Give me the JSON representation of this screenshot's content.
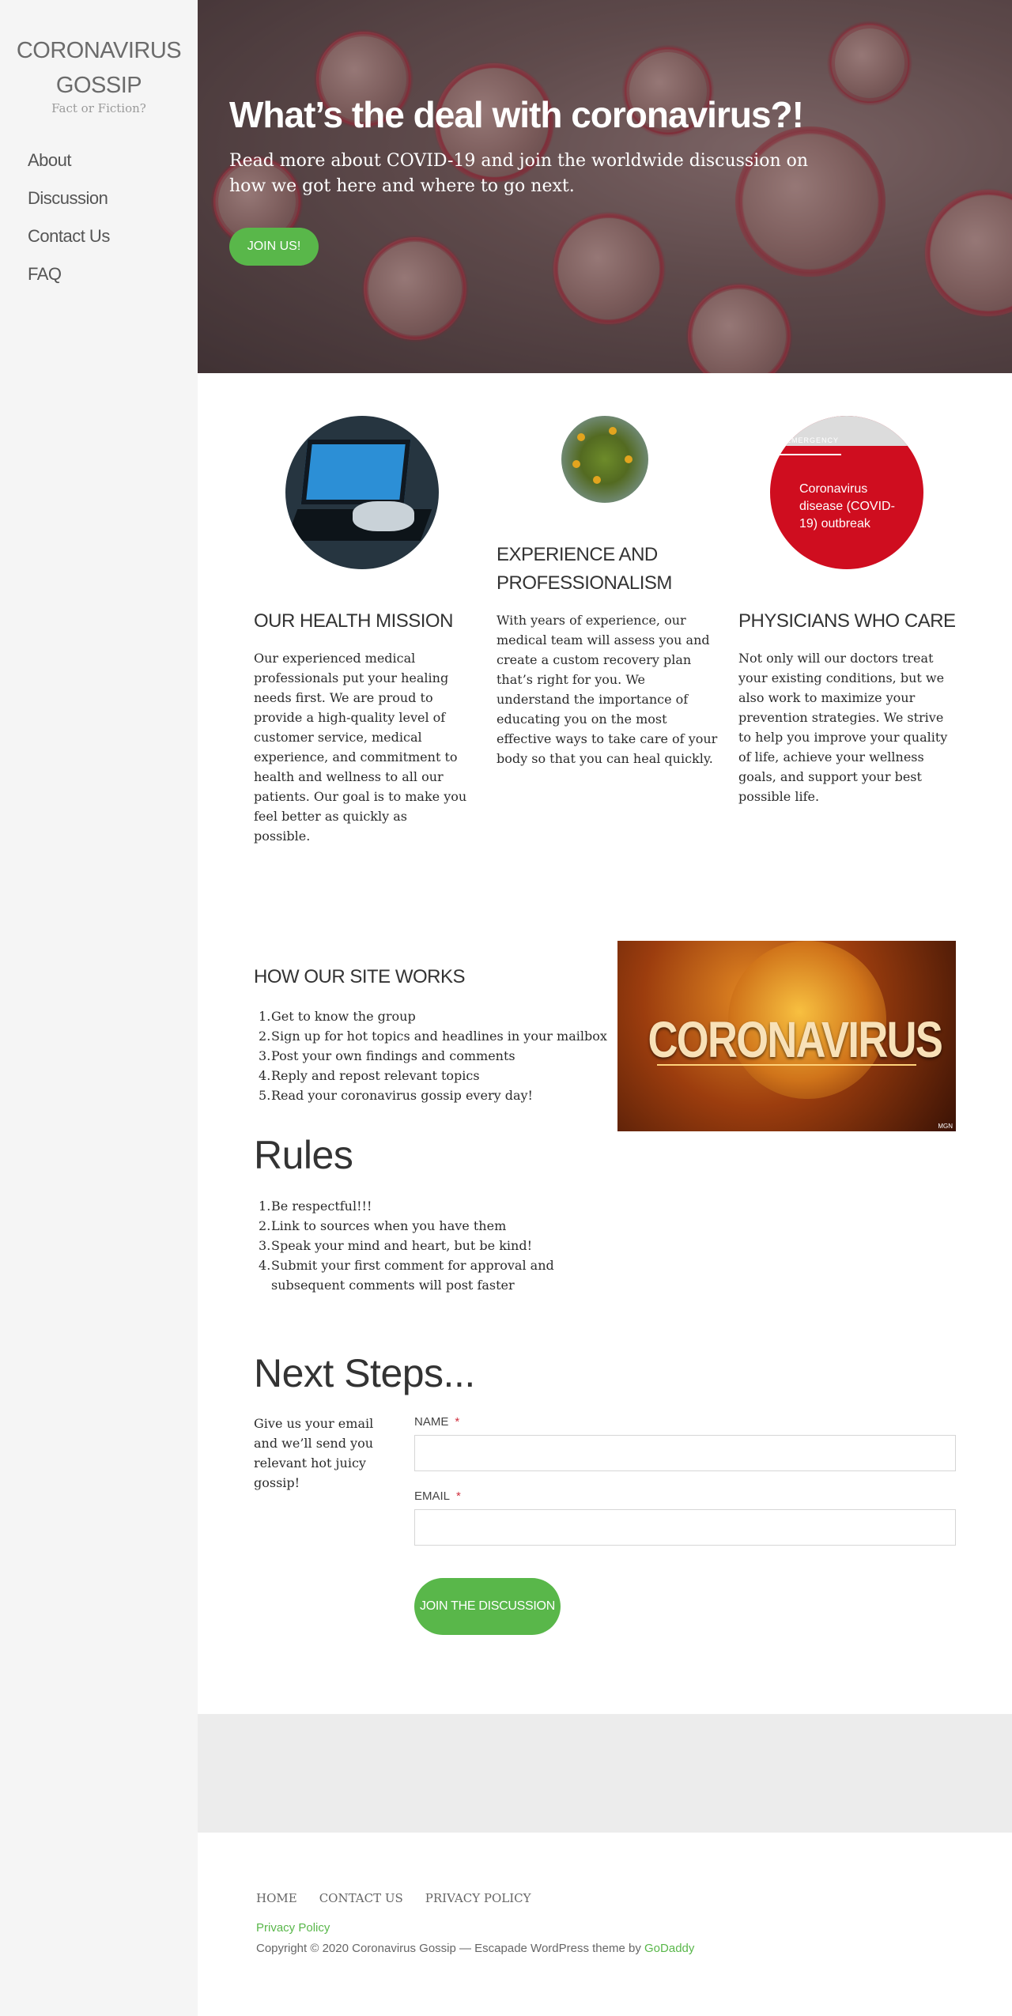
{
  "site": {
    "title_line1": "CORONAVIRUS",
    "title_line2": "GOSSIP",
    "tagline": "Fact or Fiction?"
  },
  "nav": {
    "items": [
      {
        "label": "About"
      },
      {
        "label": "Discussion"
      },
      {
        "label": "Contact Us"
      },
      {
        "label": "FAQ"
      }
    ]
  },
  "hero": {
    "title": "What’s the deal with coronavirus?!",
    "text": "Read more about COVID-19 and join the worldwide discussion on how we got here and where to go next.",
    "button_label": "JOIN US!"
  },
  "features": [
    {
      "heading": "OUR HEALTH MISSION",
      "body": "Our experienced medical professionals put your healing needs first. We are proud to provide a high-quality level of customer service, medical experience, and commitment to health and wellness to all our patients. Our goal is to make you feel better as quickly as possible."
    },
    {
      "heading": "EXPERIENCE AND PROFESSIONALISM",
      "body": "With years of experience, our medical team will assess you and create a custom recovery plan that’s right for you. We understand the importance of educating you on the most effective ways to take care of your body so that you can heal quickly."
    },
    {
      "heading": "PHYSICIANS WHO CARE",
      "body": "Not only will our doctors treat your existing conditions, but we also work to maximize your prevention strategies. We strive to help you improve your quality of life, achieve your wellness goals, and support your best possible life."
    }
  ],
  "feature_images": {
    "emergency_label": "EMERGENCY",
    "emergency_text": "Coronavirus disease (COVID-19) outbreak"
  },
  "how_it_works": {
    "heading": "HOW OUR SITE WORKS",
    "steps": [
      "Get to know the group",
      "Sign up for hot topics and headlines in your mailbox",
      "Post your own findings and comments",
      "Reply and repost relevant topics",
      "Read your coronavirus gossip every day!"
    ],
    "image_word": "CORONAVIRUS",
    "image_credit": "MGN"
  },
  "rules": {
    "heading": "Rules",
    "items": [
      "Be respectful!!!",
      "Link to sources when you have them",
      "Speak your mind and heart, but be kind!",
      "Submit your first comment for approval and subsequent comments will post faster"
    ]
  },
  "next_steps": {
    "heading": "Next Steps...",
    "intro": "Give us your email and we’ll send you relevant hot juicy gossip!",
    "name_label": "NAME",
    "email_label": "EMAIL",
    "required_mark": "*",
    "name_value": "",
    "email_value": "",
    "submit_label": "JOIN THE DISCUSSION"
  },
  "footer": {
    "links": [
      {
        "label": "HOME"
      },
      {
        "label": "CONTACT US"
      },
      {
        "label": "PRIVACY POLICY"
      }
    ],
    "privacy_label": "Privacy Policy",
    "copyright": "Copyright © 2020 Coronavirus Gossip — Escapade WordPress theme by ",
    "theme_author": "GoDaddy"
  },
  "colors": {
    "accent_green": "#59b74a",
    "sidebar_bg": "#f5f5f5",
    "footer_band": "#ececec",
    "required_red": "#d0303f"
  }
}
